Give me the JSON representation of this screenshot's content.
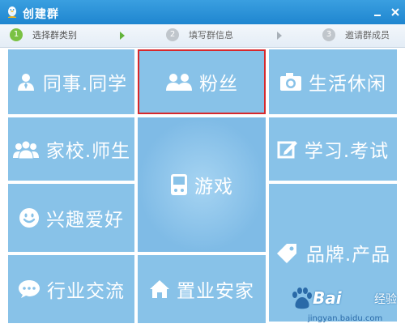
{
  "window": {
    "title": "创建群",
    "icon": "qq-penguin-icon"
  },
  "steps": [
    {
      "number": "1",
      "label": "选择群类别",
      "state": "active"
    },
    {
      "number": "2",
      "label": "填写群信息",
      "state": "inactive"
    },
    {
      "number": "3",
      "label": "邀请群成员",
      "state": "inactive"
    }
  ],
  "categories": [
    {
      "label": "同事.同学",
      "icon": "colleague-icon"
    },
    {
      "label": "粉丝",
      "icon": "fans-icon",
      "selected": true
    },
    {
      "label": "生活休闲",
      "icon": "camera-icon"
    },
    {
      "label": "家校.师生",
      "icon": "group-icon"
    },
    {
      "label": "游戏",
      "icon": "gamepad-icon"
    },
    {
      "label": "学习.考试",
      "icon": "edit-icon"
    },
    {
      "label": "兴趣爱好",
      "icon": "smiley-icon"
    },
    {
      "label": "品牌.产品",
      "icon": "tag-icon"
    },
    {
      "label": "行业交流",
      "icon": "chat-bubble-icon"
    },
    {
      "label": "置业安家",
      "icon": "home-icon"
    }
  ],
  "watermark": {
    "brand": "Bai",
    "brand2": "经验",
    "url": "jingyan.baidu.com"
  },
  "colors": {
    "tile": "#88c2e8",
    "titlebar": "#1f86d0",
    "selected_border": "#d6282c",
    "step_active": "#7ac143"
  }
}
